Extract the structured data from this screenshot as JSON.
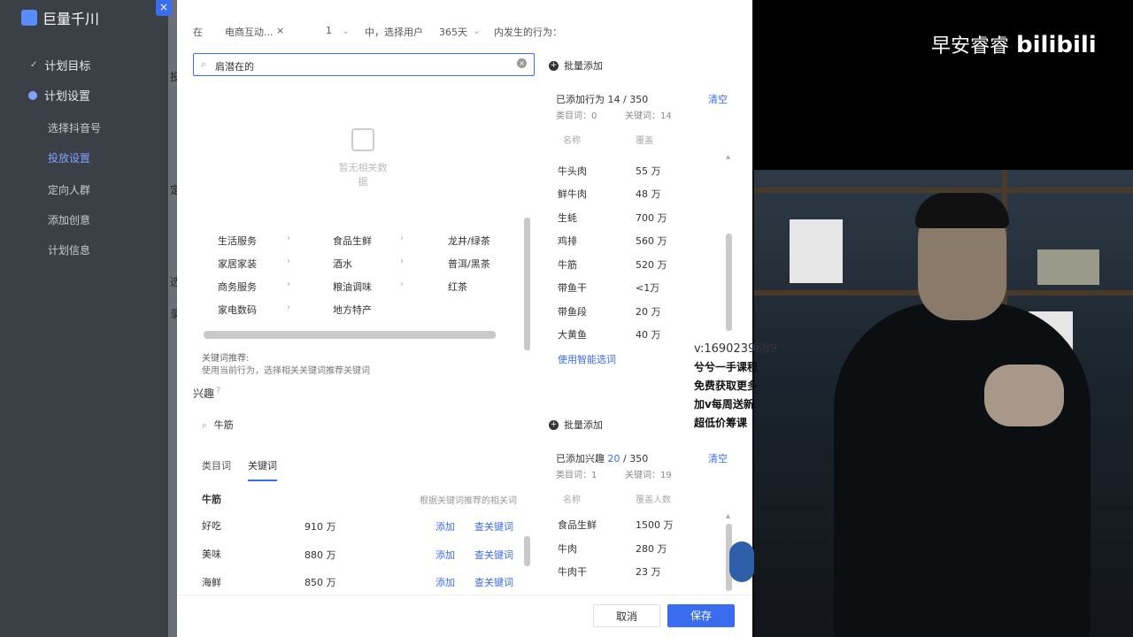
{
  "app": {
    "name": "巨量千川"
  },
  "sidebar": {
    "items": [
      {
        "label": "计划目标"
      },
      {
        "label": "计划设置"
      },
      {
        "label": "选择抖音号"
      },
      {
        "label": "投放设置"
      },
      {
        "label": "定向人群"
      },
      {
        "label": "添加创意"
      },
      {
        "label": "计划信息"
      }
    ]
  },
  "backdrop": {
    "chars": [
      "投",
      "定",
      "选",
      "录"
    ]
  },
  "modal": {
    "close": "×",
    "behavior_row": {
      "in_label": "在",
      "scene": "电商互动...",
      "scene_clear": "×",
      "count": "1",
      "mid_label": "中，选择用户",
      "days": "365天",
      "tail_label": "内发生的行为："
    },
    "search": {
      "value": "肩潜在的"
    },
    "empty_text": "暂无相关数据",
    "categories": {
      "col1": [
        "生活服务",
        "家居家装",
        "商务服务",
        "家电数码"
      ],
      "col2": [
        "食品生鲜",
        "酒水",
        "粮油调味",
        "地方特产"
      ],
      "col3": [
        "龙井/绿茶",
        "普洱/黑茶",
        "红茶"
      ]
    },
    "kw_hint": "关键词推荐:",
    "kw_hint_sub": "使用当前行为，选择相关关键词推荐关键词",
    "behavior_panel": {
      "add_btn": "批量添加",
      "title_prefix": "已添加行为",
      "count": "14",
      "total": "350",
      "sub_a": "类目词：0",
      "sub_b": "关键词：14",
      "clear": "清空",
      "col_name": "名称",
      "col_cover": "覆盖",
      "items": [
        {
          "name": "牛头肉",
          "value": "55 万"
        },
        {
          "name": "鲜牛肉",
          "value": "48 万"
        },
        {
          "name": "生蚝",
          "value": "700 万"
        },
        {
          "name": "鸡排",
          "value": "560 万"
        },
        {
          "name": "牛筋",
          "value": "520 万"
        },
        {
          "name": "带鱼干",
          "value": "<1万"
        },
        {
          "name": "带鱼段",
          "value": "20 万"
        },
        {
          "name": "大黄鱼",
          "value": "40 万"
        }
      ],
      "system_link": "使用智能选词"
    },
    "interest": {
      "title": "兴趣",
      "search_value": "牛筋",
      "tabs": [
        "类目词",
        "关键词"
      ],
      "kw_title": "牛筋",
      "kw_related_hint": "根据关键词推荐的相关词",
      "rows": [
        {
          "name": "好吃",
          "value": "910 万",
          "add": "添加",
          "look": "查关键词"
        },
        {
          "name": "美味",
          "value": "880 万",
          "add": "添加",
          "look": "查关键词"
        },
        {
          "name": "海鲜",
          "value": "850 万",
          "add": "添加",
          "look": "查关键词"
        }
      ],
      "panel": {
        "add_btn": "批量添加",
        "title_prefix": "已添加兴趣",
        "count": "20",
        "total": "350",
        "sub_a": "类目词：1",
        "sub_b": "关键词：19",
        "clear": "清空",
        "col_name": "名称",
        "col_cover": "覆盖人数",
        "items": [
          {
            "name": "食品生鲜",
            "value": "1500 万"
          },
          {
            "name": "牛肉",
            "value": "280 万"
          },
          {
            "name": "牛肉干",
            "value": "23 万"
          }
        ]
      }
    },
    "footer": {
      "cancel": "取消",
      "save": "保存"
    }
  },
  "video": {
    "watermark_text": "早安睿睿",
    "watermark_brand": "bilibili",
    "overlay": {
      "line1": "v:1690239689",
      "line2": "兮兮一手课程",
      "line3": "免费获取更多",
      "line4": "加v每周送新",
      "line5": "超低价筹课"
    }
  }
}
